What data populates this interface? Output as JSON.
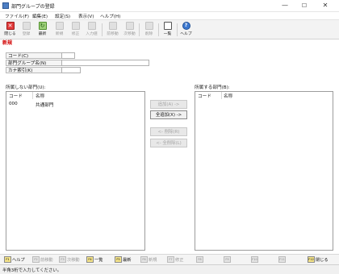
{
  "window": {
    "title": "部門グループの登録",
    "controls": {
      "minimize": "—",
      "maximize": "☐",
      "close": "✕"
    }
  },
  "menu": [
    "ファイル(F)",
    "編集(E)",
    "設定(S)",
    "表示(V)",
    "ヘルプ(H)"
  ],
  "toolbar": {
    "close": "閉じる",
    "save": "登録",
    "refresh": "最新",
    "new": "新規",
    "edit": "修正",
    "input_check": "入力値",
    "prev": "前移動",
    "next": "次移動",
    "delete": "削除",
    "list": "一覧",
    "help": "ヘルプ"
  },
  "status_new": "新規",
  "form": {
    "code_label": "コード(C)",
    "code_value": "",
    "name_label": "部門グループ名(N)",
    "name_value": "",
    "kana_label": "カナ索引(K)",
    "kana_value": ""
  },
  "left_list": {
    "title": "所属しない部門(U):",
    "col_code": "コード",
    "col_name": "名称",
    "rows": [
      {
        "code": "000",
        "name": "共通部門"
      }
    ]
  },
  "right_list": {
    "title": "所属する部門(B):",
    "col_code": "コード",
    "col_name": "名称",
    "rows": []
  },
  "move_buttons": {
    "add": "追加(A) ->",
    "add_all": "全追加(X) ->",
    "remove": "<- 削除(R)",
    "remove_all": "<- 全削除(L)"
  },
  "fkeys": [
    {
      "key": "F1",
      "label": "ヘルプ",
      "enabled": true
    },
    {
      "key": "F2",
      "label": "前移動",
      "enabled": false
    },
    {
      "key": "F3",
      "label": "次移動",
      "enabled": false
    },
    {
      "key": "F4",
      "label": "一覧",
      "enabled": true
    },
    {
      "key": "F5",
      "label": "最新",
      "enabled": true
    },
    {
      "key": "F6",
      "label": "新規",
      "enabled": false
    },
    {
      "key": "F7",
      "label": "修正",
      "enabled": false
    },
    {
      "key": "F8",
      "label": "",
      "enabled": false
    },
    {
      "key": "F9",
      "label": "",
      "enabled": false
    },
    {
      "key": "F10",
      "label": "",
      "enabled": false
    },
    {
      "key": "F11",
      "label": "",
      "enabled": false
    },
    {
      "key": "F12",
      "label": "閉じる",
      "enabled": true
    }
  ],
  "status_text": "半角3桁で入力してください。",
  "colors": {
    "new_status": "#d10000",
    "fkey_active": "#f6e58a",
    "app_icon": "#4e7fc4"
  },
  "icons": {
    "close": "close-icon",
    "save": "save-icon",
    "refresh": "refresh-icon",
    "new": "new-document-icon",
    "edit": "edit-icon",
    "input_check": "input-value-icon",
    "prev": "previous-record-icon",
    "next": "next-record-icon",
    "delete": "delete-icon",
    "list": "list-icon",
    "help": "help-icon"
  }
}
